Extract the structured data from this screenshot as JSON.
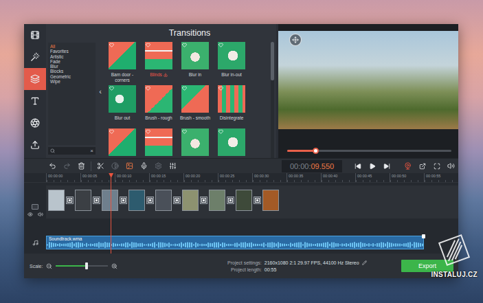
{
  "sidebar": {
    "items": [
      {
        "selected": false
      },
      {
        "selected": false
      },
      {
        "selected": true
      },
      {
        "selected": false
      },
      {
        "selected": false
      },
      {
        "selected": false
      }
    ]
  },
  "categories": {
    "items": [
      {
        "label": "All",
        "selected": true
      },
      {
        "label": "Favorites",
        "selected": false
      },
      {
        "label": "Artistic",
        "selected": false
      },
      {
        "label": "Fade",
        "selected": false
      },
      {
        "label": "Blur",
        "selected": false
      },
      {
        "label": "Blocks",
        "selected": false
      },
      {
        "label": "Geometric",
        "selected": false
      },
      {
        "label": "Wipe",
        "selected": false
      }
    ],
    "search": {
      "clear": "×"
    }
  },
  "collapse": "‹",
  "transitions": {
    "title": "Transitions",
    "items": [
      {
        "label": "Barn door - corners",
        "favorite": false,
        "download": false
      },
      {
        "label": "Blinds",
        "favorite": false,
        "download": true
      },
      {
        "label": "Blur in",
        "favorite": false,
        "download": false
      },
      {
        "label": "Blur in-out",
        "favorite": false,
        "download": false
      },
      {
        "label": "Blur out",
        "favorite": false,
        "download": false
      },
      {
        "label": "Brush - rough",
        "favorite": false,
        "download": false
      },
      {
        "label": "Brush - smooth",
        "favorite": false,
        "download": false
      },
      {
        "label": "Disintegrate",
        "favorite": false,
        "download": false
      },
      {
        "label": "",
        "favorite": false,
        "download": false
      },
      {
        "label": "",
        "favorite": false,
        "download": false
      },
      {
        "label": "",
        "favorite": false,
        "download": false
      },
      {
        "label": "",
        "favorite": false,
        "download": false
      }
    ],
    "scroll": {
      "position": 0,
      "size": 0.33
    }
  },
  "preview": {
    "position": {
      "level": 0.17
    }
  },
  "toolbar": {
    "tools": [
      {
        "selected": false,
        "disabled": false
      },
      {
        "selected": false,
        "disabled": true
      },
      {
        "selected": false,
        "disabled": false
      },
      {
        "selected": false,
        "disabled": false
      },
      {
        "selected": false,
        "disabled": true
      },
      {
        "selected": true,
        "disabled": false
      },
      {
        "selected": false,
        "disabled": false
      },
      {
        "selected": false,
        "disabled": true
      },
      {
        "selected": false,
        "disabled": false
      }
    ],
    "timecode": {
      "elapsed": "00:00:",
      "current": "09.550"
    }
  },
  "timeline": {
    "ruler": [
      "00:00:00",
      "00:00:05",
      "00:00:10",
      "00:00:15",
      "00:00:20",
      "00:00:25",
      "00:00:30",
      "00:00:35",
      "00:00:40",
      "00:00:45",
      "00:00:50",
      "00:00:55"
    ],
    "playhead": {
      "level": 0.157
    },
    "video_track": {
      "visible": true,
      "muted": false,
      "clips": [
        {
          "kind": "clip"
        },
        {
          "kind": "transition"
        },
        {
          "kind": "clip"
        },
        {
          "kind": "transition"
        },
        {
          "kind": "clip"
        },
        {
          "kind": "transition"
        },
        {
          "kind": "clip"
        },
        {
          "kind": "transition"
        },
        {
          "kind": "clip"
        },
        {
          "kind": "transition"
        },
        {
          "kind": "clip"
        },
        {
          "kind": "transition"
        },
        {
          "kind": "clip"
        },
        {
          "kind": "transition"
        },
        {
          "kind": "clip"
        },
        {
          "kind": "transition"
        },
        {
          "kind": "clip"
        }
      ]
    },
    "audio_track": {
      "name": "Soundtrack.wma"
    }
  },
  "bottom_bar": {
    "scale": {
      "label": "Scale:",
      "level": 0.58
    },
    "project_settings": {
      "label": "Project settings:",
      "value": "2160x1080 2:1 29.97 FPS, 44100 Hz Stereo"
    },
    "project_length": {
      "label": "Project length:",
      "value": "00:55"
    },
    "export": "Export"
  },
  "watermark": {
    "text": "INSTALUJ.CZ"
  }
}
